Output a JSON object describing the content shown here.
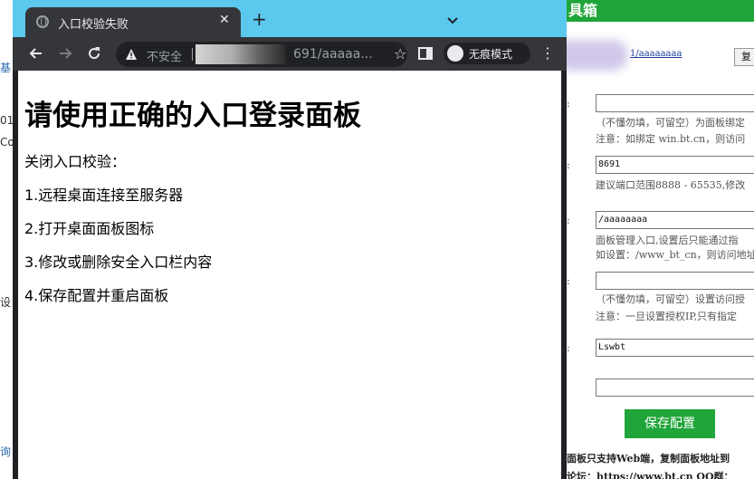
{
  "browser": {
    "tab_title": "入口校验失败",
    "new_tab_symbol": "+",
    "address_warning": "不安全",
    "url_visible": "691/aaaaa...",
    "incognito_label": "无痕模式"
  },
  "page": {
    "heading": "请使用正确的入口登录面板",
    "intro": "关闭入口校验：",
    "steps": [
      "1.远程桌面连接至服务器",
      "2.打开桌面面板图标",
      "3.修改或删除安全入口栏内容",
      "4.保存配置并重启面板"
    ]
  },
  "background_window": {
    "title_fragment": "具箱",
    "url_fragment": "1/aaaaaaaa",
    "button_fragment": "复",
    "fields": [
      {
        "value": "",
        "hint1": "（不懂勿填，可留空）为面板绑定",
        "hint2": "注意：如绑定 win.bt.cn，则访问"
      },
      {
        "value": "8691",
        "hint1": "建议端口范围8888 - 65535,修改"
      },
      {
        "value": "/aaaaaaaa",
        "hint1": "面板管理入口,设置后只能通过指",
        "hint2": "如设置：/www_bt_cn，则访问地址"
      },
      {
        "value": "",
        "hint1": "（不懂勿填，可留空）设置访问授",
        "hint2": "注意：一旦设置授权IP,只有指定"
      },
      {
        "value": "Lswbt"
      },
      {
        "value": ""
      }
    ],
    "save_button": "保存配置",
    "note": "面板只支持Web端，复制面板地址到",
    "forum": "论坛：https://www.bt.cn  QQ群："
  },
  "left_fragments": [
    "基",
    "01",
    "Co",
    "设",
    "询"
  ],
  "window_controls": {
    "minimize": "—",
    "maximize": "□",
    "close": "✕"
  },
  "colors": {
    "accent_green": "#20a53a",
    "chrome_dark": "#35363a",
    "desktop_blue": "#5bc8ee"
  }
}
